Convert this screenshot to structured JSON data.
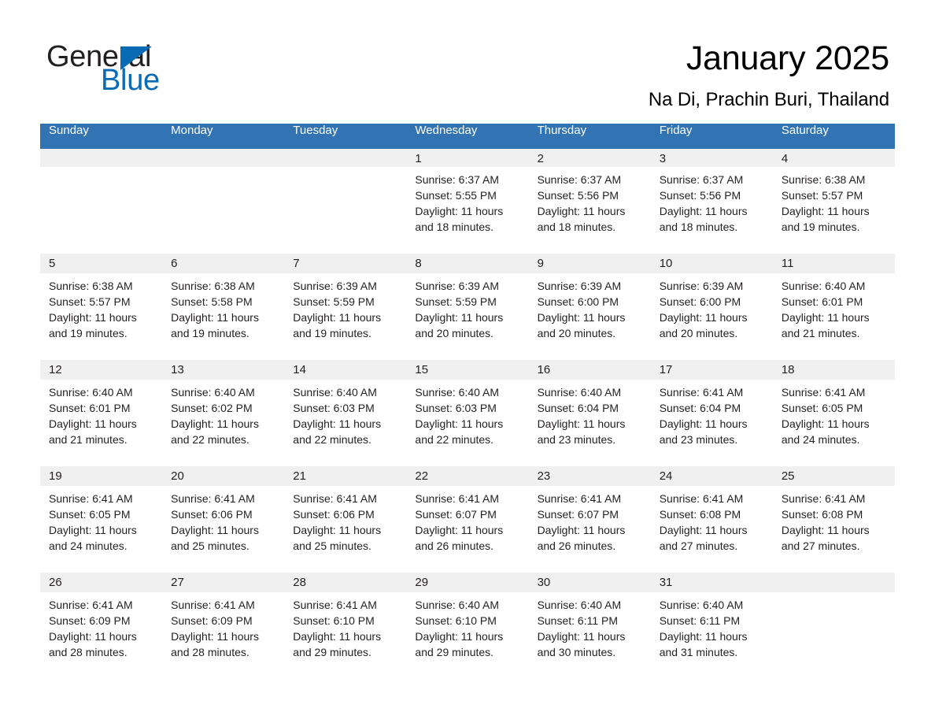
{
  "brand": {
    "name_part1": "General",
    "name_part2": "Blue",
    "triangle_icon": "triangle-icon",
    "accent_color": "#0a6bb5"
  },
  "header": {
    "title": "January 2025",
    "location": "Na Di, Prachin Buri, Thailand"
  },
  "calendar": {
    "header_color": "#3173b3",
    "daynum_band_color": "#f0f0f0",
    "weekdays": [
      "Sunday",
      "Monday",
      "Tuesday",
      "Wednesday",
      "Thursday",
      "Friday",
      "Saturday"
    ],
    "weeks": [
      [
        {
          "day": "",
          "sunrise": "",
          "sunset": "",
          "daylight": ""
        },
        {
          "day": "",
          "sunrise": "",
          "sunset": "",
          "daylight": ""
        },
        {
          "day": "",
          "sunrise": "",
          "sunset": "",
          "daylight": ""
        },
        {
          "day": "1",
          "sunrise": "Sunrise: 6:37 AM",
          "sunset": "Sunset: 5:55 PM",
          "daylight": "Daylight: 11 hours and 18 minutes."
        },
        {
          "day": "2",
          "sunrise": "Sunrise: 6:37 AM",
          "sunset": "Sunset: 5:56 PM",
          "daylight": "Daylight: 11 hours and 18 minutes."
        },
        {
          "day": "3",
          "sunrise": "Sunrise: 6:37 AM",
          "sunset": "Sunset: 5:56 PM",
          "daylight": "Daylight: 11 hours and 18 minutes."
        },
        {
          "day": "4",
          "sunrise": "Sunrise: 6:38 AM",
          "sunset": "Sunset: 5:57 PM",
          "daylight": "Daylight: 11 hours and 19 minutes."
        }
      ],
      [
        {
          "day": "5",
          "sunrise": "Sunrise: 6:38 AM",
          "sunset": "Sunset: 5:57 PM",
          "daylight": "Daylight: 11 hours and 19 minutes."
        },
        {
          "day": "6",
          "sunrise": "Sunrise: 6:38 AM",
          "sunset": "Sunset: 5:58 PM",
          "daylight": "Daylight: 11 hours and 19 minutes."
        },
        {
          "day": "7",
          "sunrise": "Sunrise: 6:39 AM",
          "sunset": "Sunset: 5:59 PM",
          "daylight": "Daylight: 11 hours and 19 minutes."
        },
        {
          "day": "8",
          "sunrise": "Sunrise: 6:39 AM",
          "sunset": "Sunset: 5:59 PM",
          "daylight": "Daylight: 11 hours and 20 minutes."
        },
        {
          "day": "9",
          "sunrise": "Sunrise: 6:39 AM",
          "sunset": "Sunset: 6:00 PM",
          "daylight": "Daylight: 11 hours and 20 minutes."
        },
        {
          "day": "10",
          "sunrise": "Sunrise: 6:39 AM",
          "sunset": "Sunset: 6:00 PM",
          "daylight": "Daylight: 11 hours and 20 minutes."
        },
        {
          "day": "11",
          "sunrise": "Sunrise: 6:40 AM",
          "sunset": "Sunset: 6:01 PM",
          "daylight": "Daylight: 11 hours and 21 minutes."
        }
      ],
      [
        {
          "day": "12",
          "sunrise": "Sunrise: 6:40 AM",
          "sunset": "Sunset: 6:01 PM",
          "daylight": "Daylight: 11 hours and 21 minutes."
        },
        {
          "day": "13",
          "sunrise": "Sunrise: 6:40 AM",
          "sunset": "Sunset: 6:02 PM",
          "daylight": "Daylight: 11 hours and 22 minutes."
        },
        {
          "day": "14",
          "sunrise": "Sunrise: 6:40 AM",
          "sunset": "Sunset: 6:03 PM",
          "daylight": "Daylight: 11 hours and 22 minutes."
        },
        {
          "day": "15",
          "sunrise": "Sunrise: 6:40 AM",
          "sunset": "Sunset: 6:03 PM",
          "daylight": "Daylight: 11 hours and 22 minutes."
        },
        {
          "day": "16",
          "sunrise": "Sunrise: 6:40 AM",
          "sunset": "Sunset: 6:04 PM",
          "daylight": "Daylight: 11 hours and 23 minutes."
        },
        {
          "day": "17",
          "sunrise": "Sunrise: 6:41 AM",
          "sunset": "Sunset: 6:04 PM",
          "daylight": "Daylight: 11 hours and 23 minutes."
        },
        {
          "day": "18",
          "sunrise": "Sunrise: 6:41 AM",
          "sunset": "Sunset: 6:05 PM",
          "daylight": "Daylight: 11 hours and 24 minutes."
        }
      ],
      [
        {
          "day": "19",
          "sunrise": "Sunrise: 6:41 AM",
          "sunset": "Sunset: 6:05 PM",
          "daylight": "Daylight: 11 hours and 24 minutes."
        },
        {
          "day": "20",
          "sunrise": "Sunrise: 6:41 AM",
          "sunset": "Sunset: 6:06 PM",
          "daylight": "Daylight: 11 hours and 25 minutes."
        },
        {
          "day": "21",
          "sunrise": "Sunrise: 6:41 AM",
          "sunset": "Sunset: 6:06 PM",
          "daylight": "Daylight: 11 hours and 25 minutes."
        },
        {
          "day": "22",
          "sunrise": "Sunrise: 6:41 AM",
          "sunset": "Sunset: 6:07 PM",
          "daylight": "Daylight: 11 hours and 26 minutes."
        },
        {
          "day": "23",
          "sunrise": "Sunrise: 6:41 AM",
          "sunset": "Sunset: 6:07 PM",
          "daylight": "Daylight: 11 hours and 26 minutes."
        },
        {
          "day": "24",
          "sunrise": "Sunrise: 6:41 AM",
          "sunset": "Sunset: 6:08 PM",
          "daylight": "Daylight: 11 hours and 27 minutes."
        },
        {
          "day": "25",
          "sunrise": "Sunrise: 6:41 AM",
          "sunset": "Sunset: 6:08 PM",
          "daylight": "Daylight: 11 hours and 27 minutes."
        }
      ],
      [
        {
          "day": "26",
          "sunrise": "Sunrise: 6:41 AM",
          "sunset": "Sunset: 6:09 PM",
          "daylight": "Daylight: 11 hours and 28 minutes."
        },
        {
          "day": "27",
          "sunrise": "Sunrise: 6:41 AM",
          "sunset": "Sunset: 6:09 PM",
          "daylight": "Daylight: 11 hours and 28 minutes."
        },
        {
          "day": "28",
          "sunrise": "Sunrise: 6:41 AM",
          "sunset": "Sunset: 6:10 PM",
          "daylight": "Daylight: 11 hours and 29 minutes."
        },
        {
          "day": "29",
          "sunrise": "Sunrise: 6:40 AM",
          "sunset": "Sunset: 6:10 PM",
          "daylight": "Daylight: 11 hours and 29 minutes."
        },
        {
          "day": "30",
          "sunrise": "Sunrise: 6:40 AM",
          "sunset": "Sunset: 6:11 PM",
          "daylight": "Daylight: 11 hours and 30 minutes."
        },
        {
          "day": "31",
          "sunrise": "Sunrise: 6:40 AM",
          "sunset": "Sunset: 6:11 PM",
          "daylight": "Daylight: 11 hours and 31 minutes."
        },
        {
          "day": "",
          "sunrise": "",
          "sunset": "",
          "daylight": ""
        }
      ]
    ]
  }
}
